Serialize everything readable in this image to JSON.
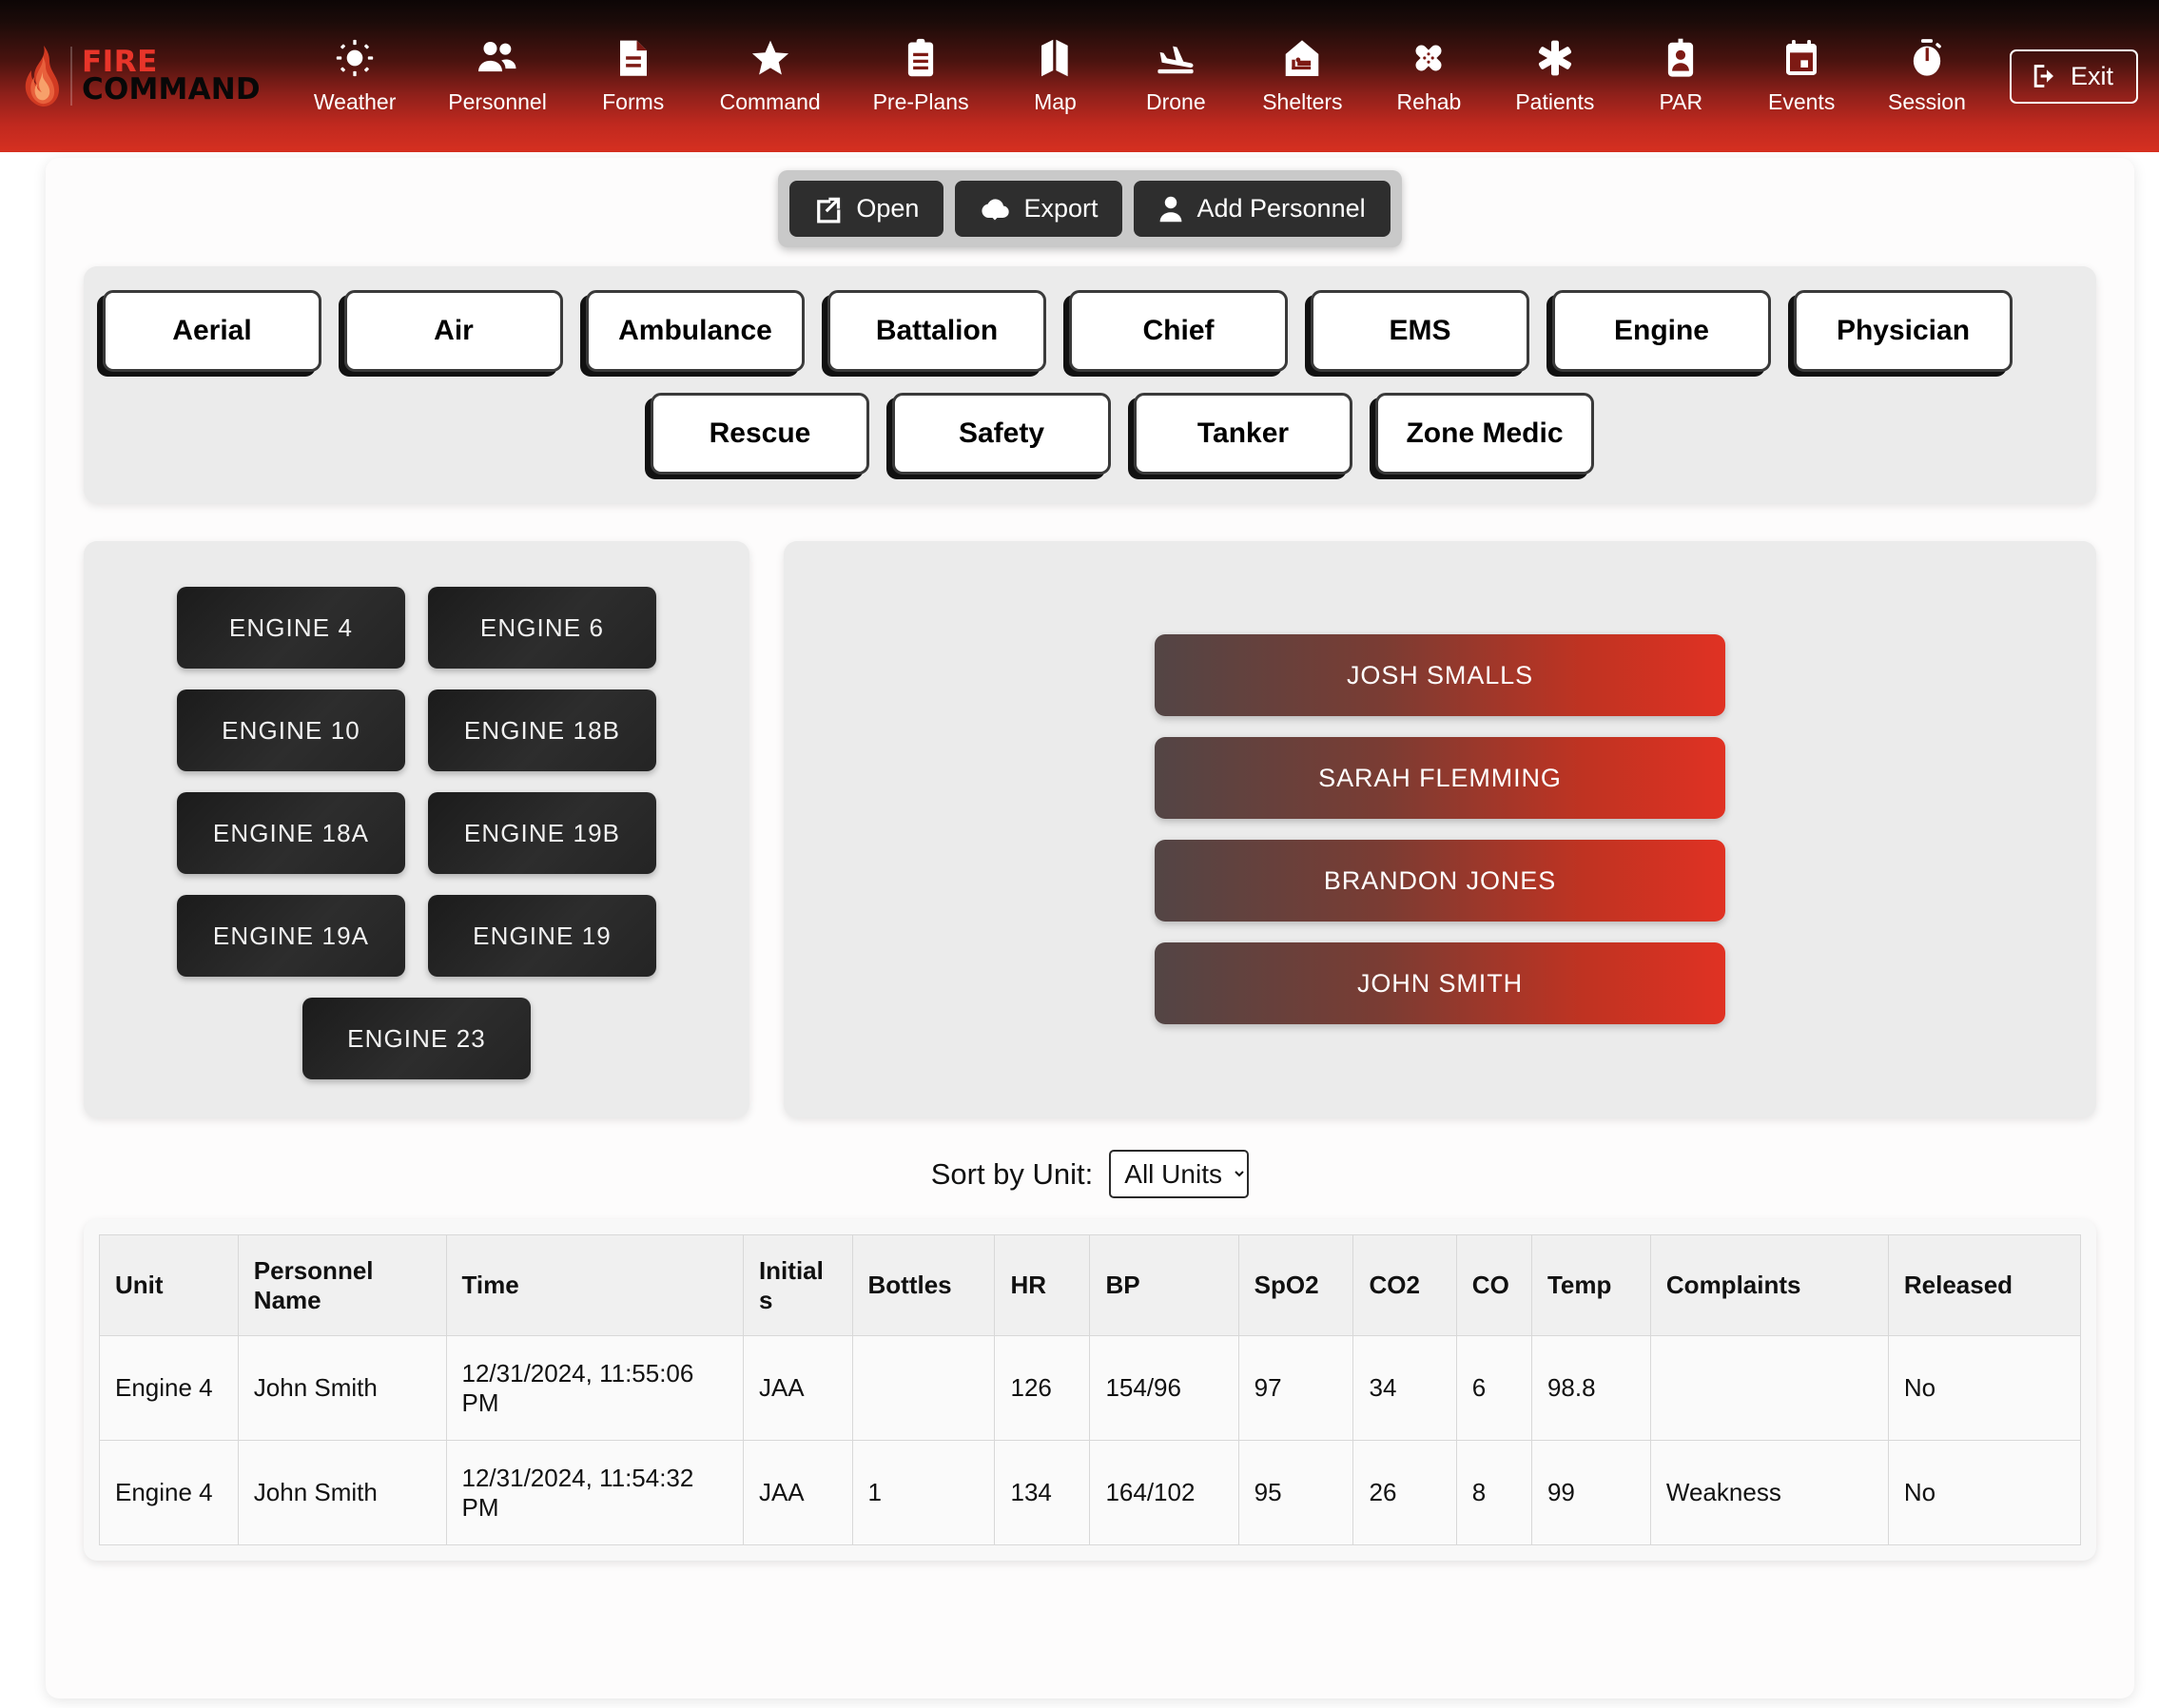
{
  "brand": {
    "fire": "FIRE",
    "command": "COMMAND"
  },
  "nav": {
    "items": [
      {
        "label": "Weather",
        "icon": "sun-icon"
      },
      {
        "label": "Personnel",
        "icon": "people-icon"
      },
      {
        "label": "Forms",
        "icon": "document-icon"
      },
      {
        "label": "Command",
        "icon": "star-icon"
      },
      {
        "label": "Pre-Plans",
        "icon": "clipboard-icon"
      },
      {
        "label": "Map",
        "icon": "map-icon"
      },
      {
        "label": "Drone",
        "icon": "plane-landing-icon"
      },
      {
        "label": "Shelters",
        "icon": "house-bed-icon"
      },
      {
        "label": "Rehab",
        "icon": "bandage-cross-icon"
      },
      {
        "label": "Patients",
        "icon": "asterisk-star-of-life-icon"
      },
      {
        "label": "PAR",
        "icon": "id-badge-icon"
      },
      {
        "label": "Events",
        "icon": "calendar-icon"
      },
      {
        "label": "Session",
        "icon": "stopwatch-icon"
      }
    ],
    "exit_label": "Exit",
    "exit_icon": "exit-arrow-icon"
  },
  "toolbar": {
    "open_label": "Open",
    "open_icon": "external-link-icon",
    "export_label": "Export",
    "export_icon": "cloud-download-icon",
    "add_personnel_label": "Add Personnel",
    "add_personnel_icon": "person-icon"
  },
  "unit_types": {
    "row1": [
      "Aerial",
      "Air",
      "Ambulance",
      "Battalion",
      "Chief",
      "EMS",
      "Engine",
      "Physician"
    ],
    "row2": [
      "Rescue",
      "Safety",
      "Tanker",
      "Zone Medic"
    ]
  },
  "units": [
    "ENGINE 4",
    "ENGINE 6",
    "ENGINE 10",
    "ENGINE 18B",
    "ENGINE 18A",
    "ENGINE 19B",
    "ENGINE 19A",
    "ENGINE 19",
    "ENGINE 23"
  ],
  "personnel": [
    "JOSH SMALLS",
    "SARAH FLEMMING",
    "BRANDON JONES",
    "JOHN SMITH"
  ],
  "sort": {
    "label": "Sort by Unit:",
    "selected": "All Units",
    "options": [
      "All Units"
    ]
  },
  "table": {
    "columns": [
      "Unit",
      "Personnel Name",
      "Time",
      "Initials",
      "Bottles",
      "HR",
      "BP",
      "SpO2",
      "CO2",
      "CO",
      "Temp",
      "Complaints",
      "Released"
    ],
    "rows": [
      {
        "unit": "Engine 4",
        "name": "John Smith",
        "time": "12/31/2024, 11:55:06 PM",
        "initials": "JAA",
        "bottles": "",
        "hr": "126",
        "bp": "154/96",
        "spo2": "97",
        "co2": "34",
        "co": "6",
        "temp": "98.8",
        "complaints": "",
        "released": "No"
      },
      {
        "unit": "Engine 4",
        "name": "John Smith",
        "time": "12/31/2024, 11:54:32 PM",
        "initials": "JAA",
        "bottles": "1",
        "hr": "134",
        "bp": "164/102",
        "spo2": "95",
        "co2": "26",
        "co": "8",
        "temp": "99",
        "complaints": "Weakness",
        "released": "No"
      }
    ]
  },
  "colors": {
    "brand_red": "#e8352a",
    "nav_gradient_bottom": "#d63020",
    "dark_button": "#2e2e2e",
    "panel_gray": "#ebebeb"
  }
}
